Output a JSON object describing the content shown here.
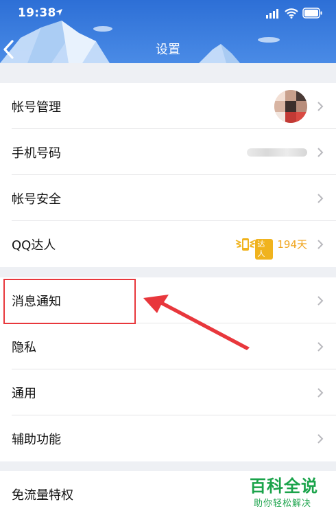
{
  "status_bar": {
    "time": "19:38"
  },
  "header": {
    "title": "设置"
  },
  "groups": [
    {
      "items": [
        {
          "label": "帐号管理"
        },
        {
          "label": "手机号码"
        },
        {
          "label": "帐号安全"
        },
        {
          "label": "QQ达人",
          "badge_text": "达人",
          "days": "194天"
        }
      ]
    },
    {
      "items": [
        {
          "label": "消息通知"
        },
        {
          "label": "隐私"
        },
        {
          "label": "通用"
        },
        {
          "label": "辅助功能"
        }
      ]
    },
    {
      "items": [
        {
          "label": "免流量特权"
        }
      ]
    }
  ],
  "watermark": {
    "title": "百科全说",
    "subtitle": "助你轻松解决"
  },
  "colors": {
    "header_blue": "#2d6fd6",
    "highlight_red": "#e8373c",
    "daren_gold": "#f0b31e",
    "watermark_green": "#1aa34a"
  }
}
